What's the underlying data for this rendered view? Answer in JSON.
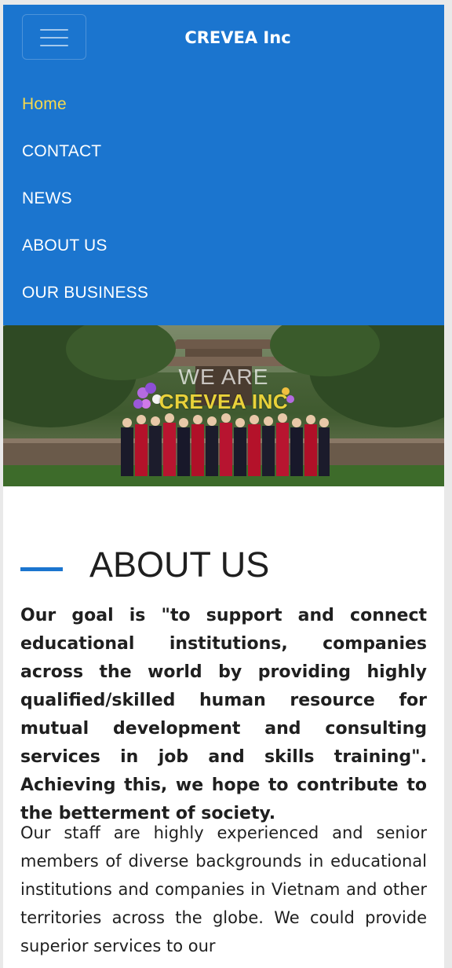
{
  "header": {
    "brand": "CREVEA Inc",
    "menu_icon": "hamburger-menu-icon"
  },
  "nav": {
    "items": [
      {
        "label": "Home",
        "active": true
      },
      {
        "label": "CONTACT",
        "active": false
      },
      {
        "label": "NEWS",
        "active": false
      },
      {
        "label": "ABOUT US",
        "active": false
      },
      {
        "label": "OUR BUSINESS",
        "active": false
      }
    ]
  },
  "hero": {
    "line1": "WE ARE",
    "line2": "CREVEA INC"
  },
  "about": {
    "heading": "ABOUT US",
    "goal_text": "Our goal is \"to support and connect educational institutions, companies across the world by providing highly qualified/skilled human resource for mutual development and consulting services in job and skills training\". Achieving this, we hope to contribute to the betterment of society.",
    "staff_text": "Our staff are highly experienced and senior members of diverse backgrounds in educational institutions and companies in Vietnam and other territories across the globe. We could provide superior services to our"
  },
  "colors": {
    "navbar": "#1b75cf",
    "active_nav": "#f7d94c",
    "accent_rule": "#1b75cf"
  }
}
